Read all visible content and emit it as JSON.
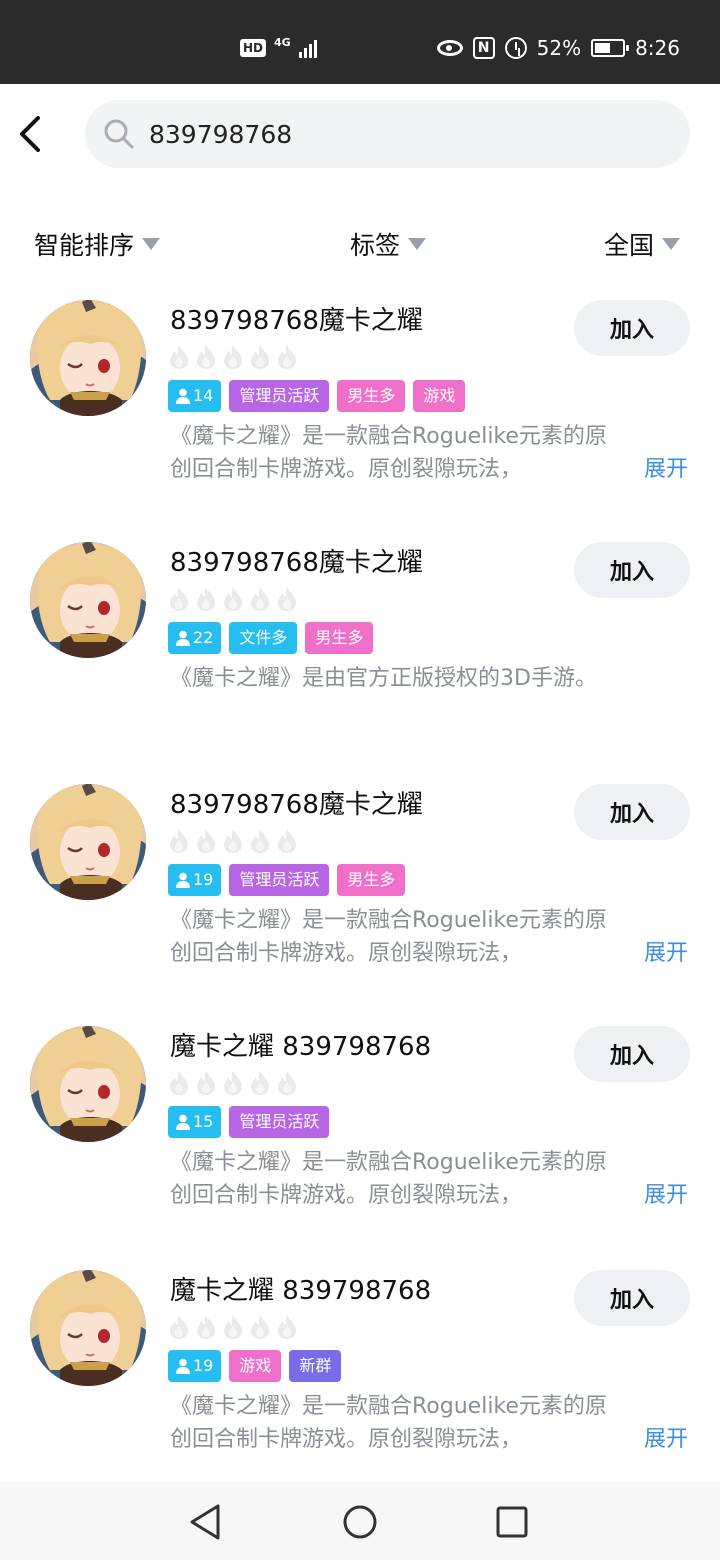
{
  "status_bar": {
    "network_hd": "HD",
    "network_type": "4G",
    "battery_percent": "52%",
    "time": "8:26"
  },
  "search": {
    "value": "839798768",
    "placeholder": ""
  },
  "filters": {
    "sort": "智能排序",
    "tags": "标签",
    "region": "全国"
  },
  "groups": [
    {
      "name": "839798768魔卡之耀",
      "members": "14",
      "tags": [
        {
          "label": "管理员活跃",
          "color": "#b866e6"
        },
        {
          "label": "男生多",
          "color": "#ef6fc9"
        },
        {
          "label": "游戏",
          "color": "#ef6fc9"
        }
      ],
      "desc_line1": "《魔卡之耀》是一款融合Roguelike元素的原",
      "desc_line2": "创回合制卡牌游戏。原创裂隙玩法，",
      "expand": "展开",
      "join": "加入"
    },
    {
      "name": "839798768魔卡之耀",
      "members": "22",
      "tags": [
        {
          "label": "文件多",
          "color": "#26bdf0"
        },
        {
          "label": "男生多",
          "color": "#ef6fc9"
        }
      ],
      "desc_line1": "《魔卡之耀》是由官方正版授权的3D手游。",
      "desc_line2": "",
      "expand": "",
      "join": "加入"
    },
    {
      "name": "839798768魔卡之耀",
      "members": "19",
      "tags": [
        {
          "label": "管理员活跃",
          "color": "#b866e6"
        },
        {
          "label": "男生多",
          "color": "#ef6fc9"
        }
      ],
      "desc_line1": "《魔卡之耀》是一款融合Roguelike元素的原",
      "desc_line2": "创回合制卡牌游戏。原创裂隙玩法，",
      "expand": "展开",
      "join": "加入"
    },
    {
      "name": "魔卡之耀 839798768",
      "members": "15",
      "tags": [
        {
          "label": "管理员活跃",
          "color": "#b866e6"
        }
      ],
      "desc_line1": "《魔卡之耀》是一款融合Roguelike元素的原",
      "desc_line2": "创回合制卡牌游戏。原创裂隙玩法，",
      "expand": "展开",
      "join": "加入"
    },
    {
      "name": "魔卡之耀 839798768",
      "members": "19",
      "tags": [
        {
          "label": "游戏",
          "color": "#ef6fc9"
        },
        {
          "label": "新群",
          "color": "#7a6be8"
        }
      ],
      "desc_line1": "《魔卡之耀》是一款融合Roguelike元素的原",
      "desc_line2": "创回合制卡牌游戏。原创裂隙玩法，",
      "expand": "展开",
      "join": "加入"
    }
  ],
  "icons": {
    "back": "back-arrow-icon",
    "search": "search-icon",
    "caret": "caret-down-icon",
    "flame": "flame-icon",
    "person": "person-icon",
    "nav_back": "triangle-back-icon",
    "nav_home": "circle-home-icon",
    "nav_recents": "square-recents-icon"
  },
  "colors": {
    "link": "#3b8fe0",
    "members_tag": "#26bdf0",
    "join_button_bg": "#eef0f4"
  }
}
